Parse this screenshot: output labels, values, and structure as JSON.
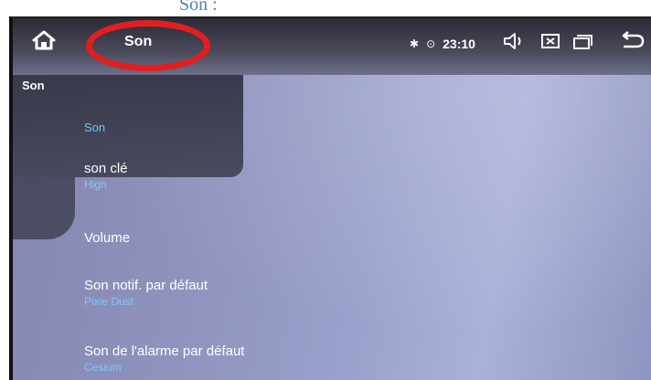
{
  "caption": "Son :",
  "statusbar": {
    "title": "Son",
    "time": "23:10",
    "bluetooth_glyph": "✱",
    "location_glyph": "⊙"
  },
  "sidebar": {
    "title": "Son"
  },
  "settings": {
    "section_header": "Son",
    "items": [
      {
        "title": "son clé",
        "summary": "High"
      },
      {
        "title": "Volume",
        "summary": ""
      },
      {
        "title": "Son notif. par défaut",
        "summary": "Pixie Dust"
      },
      {
        "title": "Son de l'alarme par défaut",
        "summary": "Cesium"
      }
    ]
  },
  "icons": {
    "home": "home-icon",
    "bluetooth": "bluetooth-icon",
    "location": "location-icon",
    "volume": "speaker-icon",
    "close": "close-box-icon",
    "recents": "recent-apps-icon",
    "back": "back-icon"
  },
  "colors": {
    "annotation_oval": "#e41e1e",
    "caption_text": "#4f81bd",
    "accent_blue": "#6ec6ff",
    "statusbar_bg": "#2c2c36"
  }
}
